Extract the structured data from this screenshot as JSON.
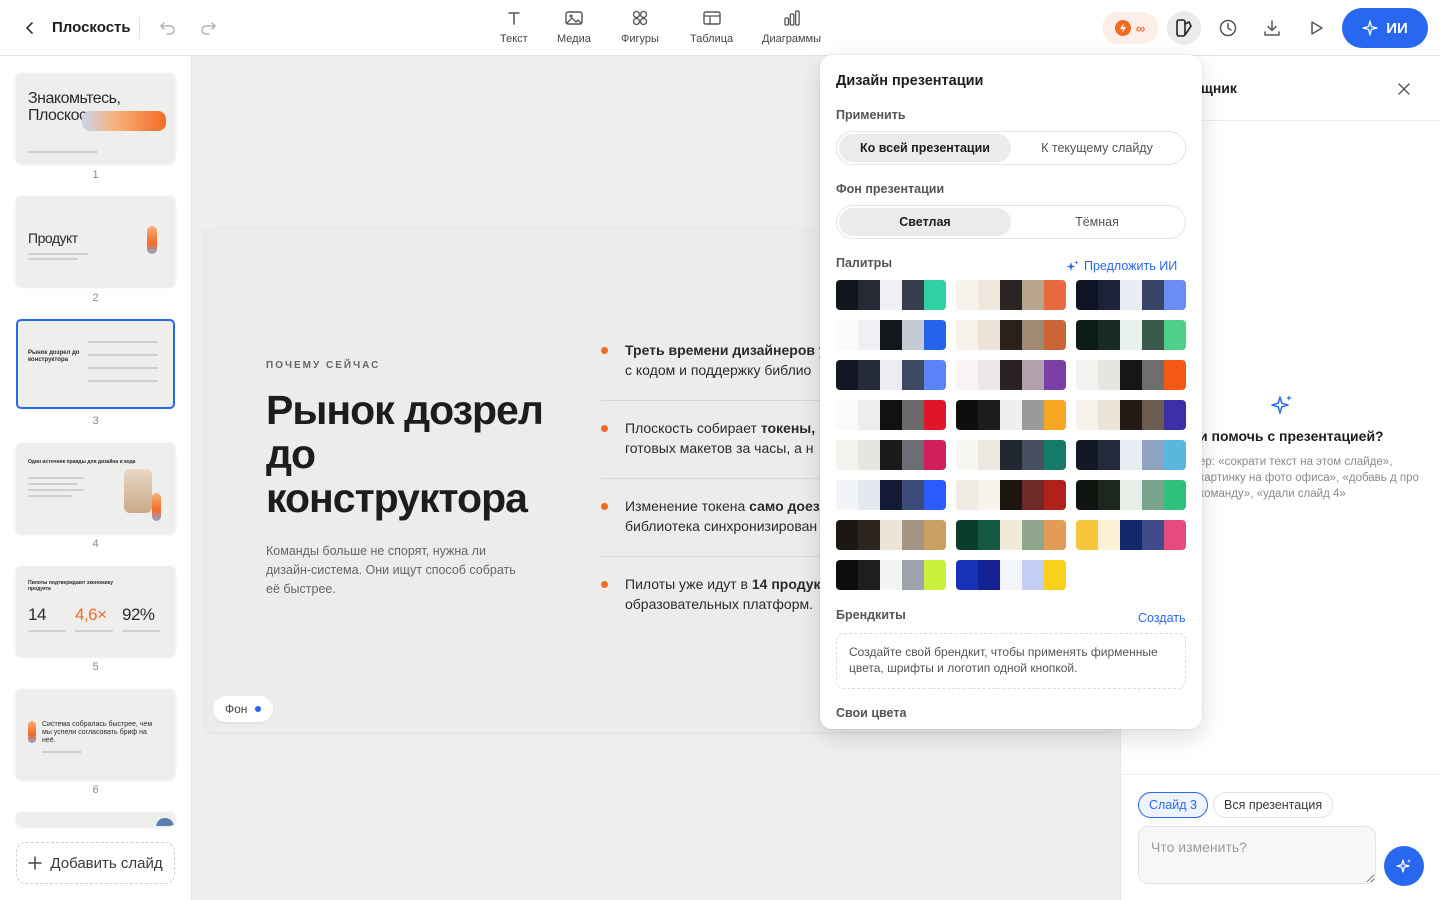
{
  "header": {
    "doc_title": "Плоскость",
    "tools": [
      {
        "label": "Текст",
        "icon": "text-icon"
      },
      {
        "label": "Медиа",
        "icon": "image-icon"
      },
      {
        "label": "Фигуры",
        "icon": "shapes-icon"
      },
      {
        "label": "Таблица",
        "icon": "table-icon"
      },
      {
        "label": "Диаграммы",
        "icon": "chart-icon"
      }
    ],
    "credits": "∞",
    "ai_button": "ИИ"
  },
  "sidebar": {
    "slides": [
      {
        "num": "1",
        "title": "Знакомьтесь, Плоскость"
      },
      {
        "num": "2",
        "title": "Продукт"
      },
      {
        "num": "3",
        "title": "Рынок дозрел до конструктора"
      },
      {
        "num": "4",
        "title": "Один источник правды для дизайна и кода"
      },
      {
        "num": "5",
        "title": "Пилоты подтверждают экономику продукта",
        "stats": [
          "14",
          "4,6×",
          "92%"
        ]
      },
      {
        "num": "6",
        "title": "Система собралась быстрее, чем мы успели согласовать бриф на неё."
      }
    ],
    "add_slide": "Добавить слайд"
  },
  "slide": {
    "eyebrow": "ПОЧЕМУ СЕЙЧАС",
    "headline": "Рынок дозрел до конструктора",
    "lede": "Команды больше не спорят, нужна ли дизайн-система. Они ищут способ собрать её быстрее.",
    "bullets": [
      {
        "bold": "Треть времени дизайнеров у",
        "rest": "",
        "line2": "с кодом и поддержку библио"
      },
      {
        "bold": "",
        "pre": "Плоскость собирает ",
        "strong": "токены,",
        "line2": "готовых макетов за часы, а н"
      },
      {
        "pre": "Изменение токена ",
        "strong": "само доез",
        "line2": "библиотека синхронизирован"
      },
      {
        "pre": "Пилоты уже идут в ",
        "strong": "14 продук",
        "line2": "образовательных платформ."
      }
    ],
    "bg_chip": "Фон"
  },
  "design_panel": {
    "title": "Дизайн презентации",
    "apply_label": "Применить",
    "apply_options": [
      "Ко всей презентации",
      "К текущему слайду"
    ],
    "bg_label": "Фон презентации",
    "bg_options": [
      "Светлая",
      "Тёмная"
    ],
    "palettes_label": "Палитры",
    "suggest_ai": "Предложить ИИ",
    "palettes": [
      [
        "#11151c",
        "#252a35",
        "#eef0f4",
        "#363d4c",
        "#2fd1a3"
      ],
      [
        "#f7f3ec",
        "#efe7db",
        "#2b2621",
        "#b9a48e",
        "#ea6a3f"
      ],
      [
        "#0f1424",
        "#1c2238",
        "#e9ecf5",
        "#3a4466",
        "#6b8cf5"
      ],
      [
        "#fbfbfb",
        "#eef0f4",
        "#14171c",
        "#c4c9d2",
        "#2563eb"
      ],
      [
        "#f6f1ea",
        "#ece2d6",
        "#2a211b",
        "#a08a73",
        "#c96536"
      ],
      [
        "#0c1b17",
        "#172a24",
        "#eaf2ee",
        "#375a4b",
        "#4ed08a"
      ],
      [
        "#131722",
        "#252b3a",
        "#eceef3",
        "#3e4a63",
        "#5b83f8"
      ],
      [
        "#f7f4f3",
        "#ece7e7",
        "#2a2026",
        "#b2a0ab",
        "#7b3fa6"
      ],
      [
        "#f2f2f0",
        "#e5e5e2",
        "#161616",
        "#6e6e6c",
        "#f45a14"
      ],
      [
        "#fafafa",
        "#ededed",
        "#111111",
        "#6a6a6a",
        "#e0142a"
      ],
      [
        "#0e0e0e",
        "#1c1c1c",
        "#efefef",
        "#9a9a9a",
        "#f6a623"
      ],
      [
        "#f6f2ea",
        "#ebe3d6",
        "#231a16",
        "#6c5c50",
        "#3d2fa8"
      ],
      [
        "#f2f2ee",
        "#e6e6e1",
        "#1a1a1a",
        "#6b6e75",
        "#d21e5c"
      ],
      [
        "#f8f6f1",
        "#ece8df",
        "#222831",
        "#475061",
        "#157a68"
      ],
      [
        "#121826",
        "#222a3c",
        "#e8ecf3",
        "#8ea3c0",
        "#5ab6dd"
      ],
      [
        "#f3f4f7",
        "#e4e7ee",
        "#121a36",
        "#3b4a78",
        "#2b5cff"
      ],
      [
        "#f0ebe2",
        "#f8f4ec",
        "#1c1612",
        "#6e2a26",
        "#b2201c"
      ],
      [
        "#0f1411",
        "#1e2620",
        "#e9eee9",
        "#7aa38c",
        "#2fc17a"
      ],
      [
        "#1b1712",
        "#2b251e",
        "#ece4d6",
        "#a29581",
        "#c9a061"
      ],
      [
        "#0b3d2c",
        "#145a43",
        "#f1ead9",
        "#8fa68d",
        "#e29c56"
      ],
      [
        "#f7c53b",
        "#fbf1d4",
        "#13276b",
        "#414a8a",
        "#e54b7f"
      ],
      [
        "#0d0d0f",
        "#1e1e21",
        "#f4f4f4",
        "#9ea3ad",
        "#c8f03c"
      ],
      [
        "#1930b8",
        "#142293",
        "#f4f5fb",
        "#c6cdf2",
        "#f8d21a"
      ]
    ],
    "brandkit_label": "Брендкиты",
    "brandkit_create": "Создать",
    "brandkit_hint": "Создайте свой брендкит, чтобы применять фирменные цвета, шрифты и логотип одной кнопкой.",
    "custom_colors_label": "Свои цвета"
  },
  "assistant": {
    "title": "щник",
    "question": "и помочь с презентацией?",
    "hint": "ер: «сократи текст на этом слайде», картинку на фото офиса», «добавь д про команду», «удали слайд 4»",
    "scope_slide": "Слайд 3",
    "scope_all": "Вся презентация",
    "input_placeholder": "Что изменить?"
  },
  "colors": {
    "accent": "#2867f0",
    "orange": "#f46a25"
  }
}
